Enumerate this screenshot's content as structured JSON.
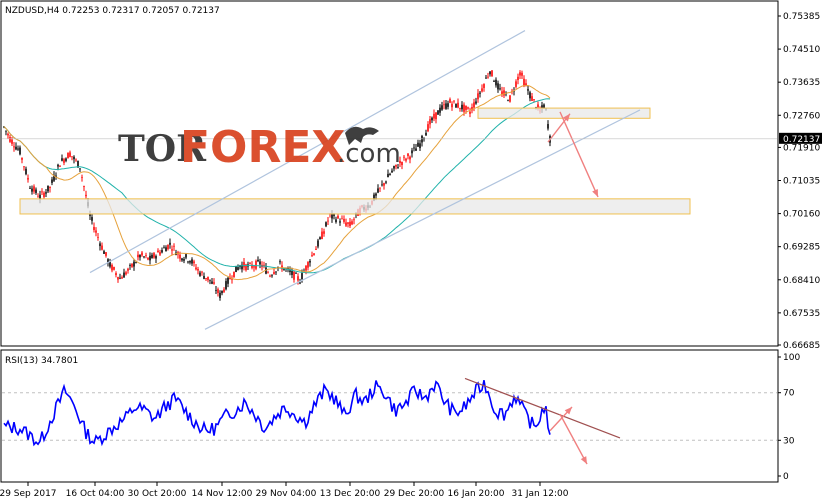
{
  "chart_data": [
    {
      "type": "candlestick",
      "header_text": "NZDUSD,H4  0.72253 0.72317 0.72057 0.72137",
      "symbol": "NZDUSD,H4",
      "ohlc_last": {
        "open": 0.72253,
        "high": 0.72317,
        "low": 0.72057,
        "close": 0.72137
      },
      "ylim": [
        0.66685,
        0.75385
      ],
      "y_ticks": [
        "0.75385",
        "0.74510",
        "0.73635",
        "0.72760",
        "0.71910",
        "0.71035",
        "0.70160",
        "0.69285",
        "0.68410",
        "0.67535",
        "0.66685"
      ],
      "current_price_label": "0.72137",
      "x_tick_labels": [
        "29 Sep 2017",
        "16 Oct 04:00",
        "30 Oct 20:00",
        "14 Nov 12:00",
        "29 Nov 04:00",
        "13 Dec 20:00",
        "29 Dec 20:00",
        "16 Jan 20:00",
        "31 Jan 12:00"
      ],
      "price_path": [
        [
          0,
          0.7265
        ],
        [
          10,
          0.7215
        ],
        [
          20,
          0.718
        ],
        [
          30,
          0.709
        ],
        [
          40,
          0.706
        ],
        [
          50,
          0.7085
        ],
        [
          60,
          0.715
        ],
        [
          70,
          0.7175
        ],
        [
          80,
          0.714
        ],
        [
          90,
          0.701
        ],
        [
          100,
          0.694
        ],
        [
          110,
          0.688
        ],
        [
          120,
          0.6845
        ],
        [
          130,
          0.687
        ],
        [
          140,
          0.6905
        ],
        [
          150,
          0.6895
        ],
        [
          160,
          0.6915
        ],
        [
          170,
          0.6935
        ],
        [
          180,
          0.6905
        ],
        [
          190,
          0.6895
        ],
        [
          200,
          0.686
        ],
        [
          210,
          0.684
        ],
        [
          220,
          0.68
        ],
        [
          230,
          0.6845
        ],
        [
          240,
          0.688
        ],
        [
          250,
          0.6875
        ],
        [
          260,
          0.6885
        ],
        [
          270,
          0.6855
        ],
        [
          280,
          0.688
        ],
        [
          290,
          0.686
        ],
        [
          300,
          0.684
        ],
        [
          310,
          0.6895
        ],
        [
          320,
          0.6945
        ],
        [
          330,
          0.701
        ],
        [
          340,
          0.7
        ],
        [
          350,
          0.6985
        ],
        [
          360,
          0.7025
        ],
        [
          370,
          0.704
        ],
        [
          380,
          0.708
        ],
        [
          390,
          0.712
        ],
        [
          400,
          0.715
        ],
        [
          410,
          0.717
        ],
        [
          420,
          0.72
        ],
        [
          430,
          0.7255
        ],
        [
          440,
          0.729
        ],
        [
          450,
          0.731
        ],
        [
          460,
          0.73
        ],
        [
          470,
          0.7285
        ],
        [
          480,
          0.7335
        ],
        [
          490,
          0.7395
        ],
        [
          500,
          0.734
        ],
        [
          510,
          0.732
        ],
        [
          520,
          0.739
        ],
        [
          530,
          0.733
        ],
        [
          540,
          0.7285
        ],
        [
          545,
          0.7305
        ],
        [
          550,
          0.7214
        ]
      ],
      "annotations": {
        "upper_channel_line": [
          [
            90,
            0.686
          ],
          [
            525,
            0.75
          ]
        ],
        "lower_channel_line": [
          [
            205,
            0.671
          ],
          [
            640,
            0.729
          ]
        ],
        "horizontal_zones": [
          {
            "x": [
              20,
              690
            ],
            "y": [
              0.7015,
              0.7055
            ]
          },
          {
            "x": [
              478,
              650
            ],
            "y": [
              0.7268,
              0.7295
            ]
          }
        ],
        "arrows": [
          {
            "from": [
              548,
              0.7205
            ],
            "to": [
              570,
              0.728
            ]
          },
          {
            "from": [
              560,
              0.7285
            ],
            "to": [
              598,
              0.706
            ]
          }
        ]
      },
      "colors": {
        "bull": "#000000",
        "bear": "#ff0000",
        "ma_slow": "#20b2aa",
        "ma_fast": "#e6a23c",
        "channel": "#b0c4de",
        "zone": "#e8e8e8",
        "zone_border": "#f0c050",
        "arrow": "#f08080"
      }
    },
    {
      "type": "line",
      "header_text": "RSI(13) 34.7801",
      "name": "RSI(13)",
      "value": 34.7801,
      "ylim": [
        0,
        100
      ],
      "y_ticks": [
        "100",
        "70",
        "30",
        "0"
      ],
      "levels": [
        70,
        30
      ],
      "rsi_path": [
        [
          0,
          42
        ],
        [
          20,
          40
        ],
        [
          40,
          28
        ],
        [
          55,
          55
        ],
        [
          65,
          72
        ],
        [
          75,
          58
        ],
        [
          85,
          38
        ],
        [
          95,
          28
        ],
        [
          105,
          35
        ],
        [
          115,
          42
        ],
        [
          125,
          48
        ],
        [
          135,
          58
        ],
        [
          145,
          55
        ],
        [
          155,
          48
        ],
        [
          165,
          58
        ],
        [
          175,
          65
        ],
        [
          185,
          55
        ],
        [
          195,
          45
        ],
        [
          205,
          38
        ],
        [
          215,
          40
        ],
        [
          225,
          50
        ],
        [
          235,
          55
        ],
        [
          245,
          62
        ],
        [
          255,
          52
        ],
        [
          265,
          40
        ],
        [
          275,
          50
        ],
        [
          285,
          58
        ],
        [
          295,
          52
        ],
        [
          305,
          45
        ],
        [
          315,
          60
        ],
        [
          325,
          72
        ],
        [
          335,
          65
        ],
        [
          345,
          50
        ],
        [
          355,
          68
        ],
        [
          365,
          62
        ],
        [
          375,
          75
        ],
        [
          385,
          70
        ],
        [
          395,
          55
        ],
        [
          405,
          60
        ],
        [
          415,
          72
        ],
        [
          425,
          65
        ],
        [
          435,
          78
        ],
        [
          445,
          62
        ],
        [
          455,
          52
        ],
        [
          465,
          58
        ],
        [
          475,
          70
        ],
        [
          485,
          78
        ],
        [
          495,
          55
        ],
        [
          505,
          52
        ],
        [
          515,
          68
        ],
        [
          525,
          52
        ],
        [
          535,
          40
        ],
        [
          545,
          60
        ],
        [
          550,
          34.78
        ]
      ],
      "annotations": {
        "trendline": [
          [
            465,
            82
          ],
          [
            620,
            32
          ]
        ],
        "arrows": [
          {
            "from": [
              550,
              38
            ],
            "to": [
              572,
              58
            ]
          },
          {
            "from": [
              560,
              52
            ],
            "to": [
              587,
              10
            ]
          }
        ]
      },
      "colors": {
        "line": "#0000ff",
        "trend": "#a05050",
        "arrow": "#f08080"
      }
    }
  ],
  "watermark": {
    "part1": "TOR",
    "part2": "FOREX",
    "part3": ".com"
  }
}
